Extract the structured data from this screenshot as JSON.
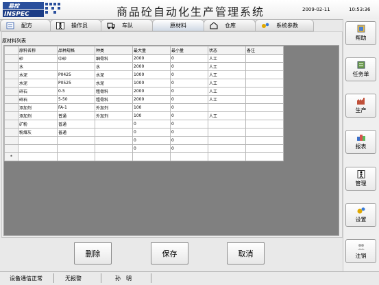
{
  "header": {
    "logo_text_top": "易控",
    "logo_text_bottom": "INSPEC",
    "title": "商品砼自动化生产管理系统",
    "date": "2009-02-11",
    "time": "10:53:36"
  },
  "tabs": [
    {
      "label": "配方",
      "icon": "recipe-icon"
    },
    {
      "label": "操作员",
      "icon": "operator-icon"
    },
    {
      "label": "车队",
      "icon": "truck-icon"
    },
    {
      "label": "原材料",
      "icon": "none"
    },
    {
      "label": "仓库",
      "icon": "warehouse-icon"
    },
    {
      "label": "系统参数",
      "icon": "gears-icon"
    }
  ],
  "materials": {
    "legend": "原材料列表",
    "columns": [
      "原料名称",
      "品种规格",
      "种类",
      "最大量",
      "最小量",
      "状态",
      "备注"
    ],
    "rows": [
      [
        "砂",
        "中砂",
        "细骨料",
        "2000",
        "0",
        "人工",
        ""
      ],
      [
        "水",
        "",
        "水",
        "2000",
        "0",
        "人工",
        ""
      ],
      [
        "水泥",
        "P0425",
        "水泥",
        "1000",
        "0",
        "人工",
        ""
      ],
      [
        "水泥",
        "P0525",
        "水泥",
        "1000",
        "0",
        "人工",
        ""
      ],
      [
        "碎石",
        "0-5",
        "粗骨料",
        "2000",
        "0",
        "人工",
        ""
      ],
      [
        "碎石",
        "5-50",
        "粗骨料",
        "2000",
        "0",
        "人工",
        ""
      ],
      [
        "添加剂",
        "FA-1",
        "外加剂",
        "100",
        "0",
        "",
        ""
      ],
      [
        "添加剂",
        "普通",
        "外加剂",
        "100",
        "0",
        "人工",
        ""
      ],
      [
        "矿粉",
        "普通",
        "",
        "0",
        "0",
        "",
        ""
      ],
      [
        "粉煤灰",
        "普通",
        "",
        "0",
        "0",
        "",
        ""
      ],
      [
        "",
        "",
        "",
        "0",
        "0",
        "",
        ""
      ],
      [
        "",
        "",
        "",
        "0",
        "0",
        "",
        ""
      ],
      [
        "",
        "",
        "",
        "",
        "",
        "",
        ""
      ]
    ],
    "new_row_marker": "*"
  },
  "actions": {
    "delete": "删除",
    "save": "保存",
    "cancel": "取消"
  },
  "sidebar": [
    {
      "label": "帮助",
      "icon": "help-icon"
    },
    {
      "label": "任务单",
      "icon": "task-list-icon"
    },
    {
      "label": "生产",
      "icon": "factory-icon"
    },
    {
      "label": "报表",
      "icon": "report-icon"
    },
    {
      "label": "管理",
      "icon": "management-icon"
    },
    {
      "label": "设置",
      "icon": "settings-icon"
    },
    {
      "label": "注销",
      "icon": "logout-icon"
    }
  ],
  "status": {
    "comm": "设备通信正常",
    "alarm": "无报警",
    "user": "孙　明"
  }
}
